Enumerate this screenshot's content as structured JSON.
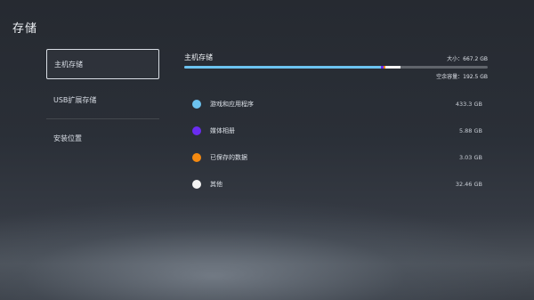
{
  "page": {
    "title": "存储"
  },
  "sidebar": {
    "items": [
      {
        "label": "主机存储",
        "selected": true
      },
      {
        "label": "USB扩展存储",
        "selected": false
      },
      {
        "label": "安装位置",
        "selected": false
      }
    ]
  },
  "storage": {
    "title": "主机存储",
    "size": "大小：667.2 GB",
    "free": "空余容量：192.5 GB",
    "usage_segments": [
      {
        "name": "游戏和应用程序",
        "color": "#6cc3f0",
        "fraction": 0.6494
      },
      {
        "name": "媒体相册",
        "color": "#6a2cf0",
        "fraction": 0.0088
      },
      {
        "name": "已保存的数据",
        "color": "#f58a10",
        "fraction": 0.0045
      },
      {
        "name": "其他",
        "color": "#f4f4f4",
        "fraction": 0.0487
      }
    ],
    "categories": [
      {
        "label": "游戏和应用程序",
        "value": "433.3 GB",
        "color": "#6cc3f0"
      },
      {
        "label": "媒体相册",
        "value": "5.88 GB",
        "color": "#6a2cf0"
      },
      {
        "label": "已保存的数据",
        "value": "3.03 GB",
        "color": "#f58a10"
      },
      {
        "label": "其他",
        "value": "32.46 GB",
        "color": "#f4f4f4"
      }
    ]
  }
}
